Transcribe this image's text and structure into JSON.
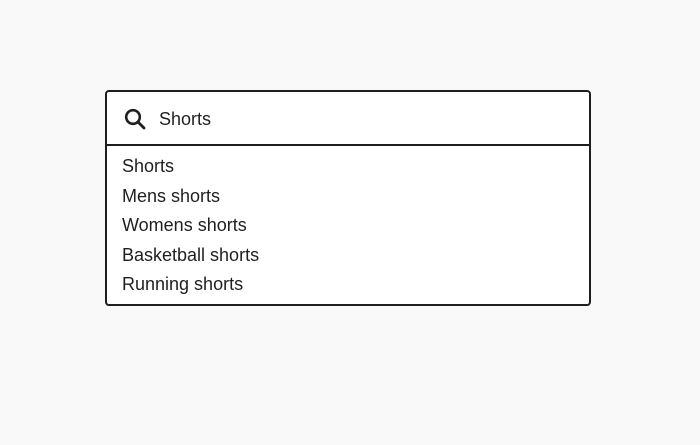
{
  "search": {
    "icon": "search-icon",
    "value": "Shorts"
  },
  "suggestions": [
    {
      "label": "Shorts"
    },
    {
      "label": "Mens shorts"
    },
    {
      "label": "Womens shorts"
    },
    {
      "label": "Basketball shorts"
    },
    {
      "label": "Running shorts"
    }
  ],
  "colors": {
    "background": "#f9f9f9",
    "border": "#1f1f1f",
    "text": "#1f1f1f",
    "panel": "#ffffff"
  }
}
